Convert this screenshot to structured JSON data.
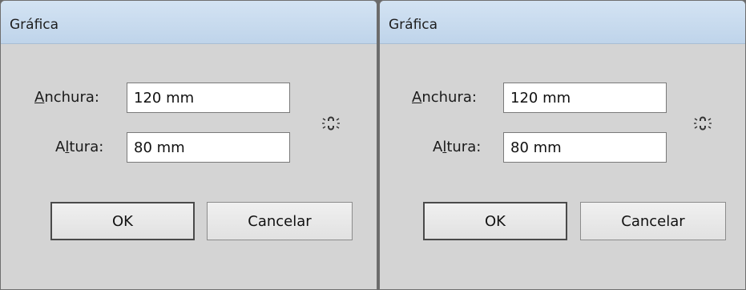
{
  "dialogs": [
    {
      "title": "Gráfica",
      "width_label": {
        "mnemonic": "A",
        "rest": "nchura:"
      },
      "width_value": "120 mm",
      "height_label": {
        "before": "A",
        "mnemonic": "l",
        "rest": "tura:"
      },
      "height_value": "80 mm",
      "ok_label": "OK",
      "cancel_label": "Cancelar"
    },
    {
      "title": "Gráfica",
      "width_label": {
        "mnemonic": "A",
        "rest": "nchura:"
      },
      "width_value": "120 mm",
      "height_label": {
        "before": "A",
        "mnemonic": "l",
        "rest": "tura:"
      },
      "height_value": "80 mm",
      "ok_label": "OK",
      "cancel_label": "Cancelar"
    }
  ],
  "icons": {
    "constrain": "broken-chain-link-icon"
  },
  "colors": {
    "titlebar": "#c7d9ed",
    "dialog_bg": "#d4d4d4",
    "field_bg": "#ffffff"
  }
}
